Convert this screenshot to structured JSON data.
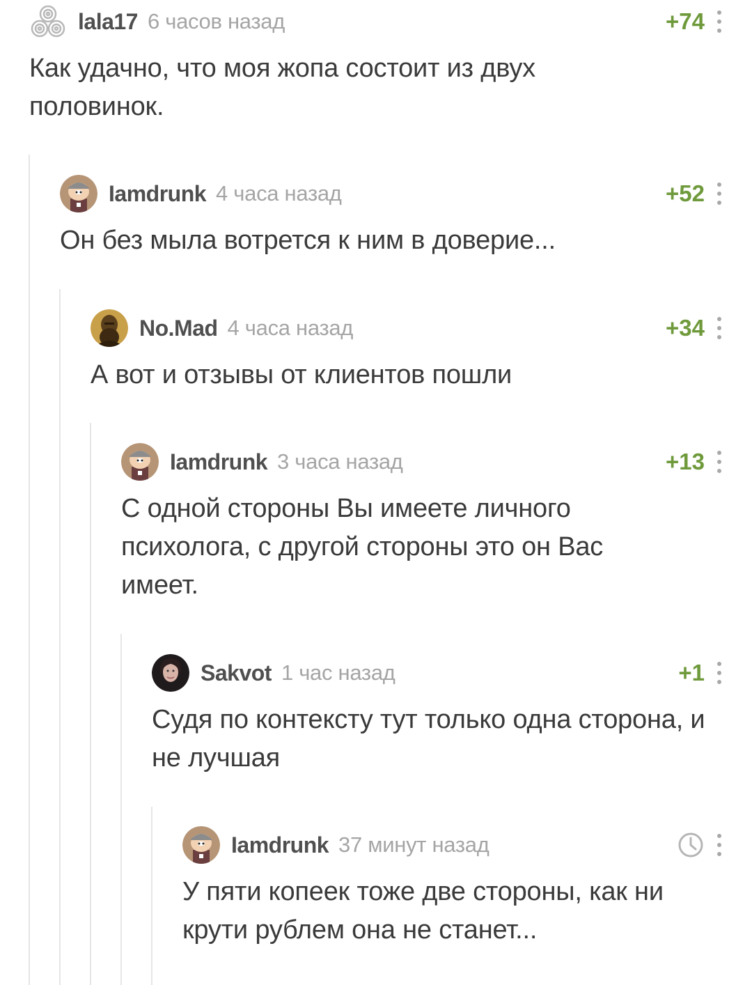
{
  "comments": [
    {
      "author": "lala17",
      "time": "6 часов назад",
      "rating": "+74",
      "text": "Как удачно, что моя жопа состоит из двух половинок.",
      "avatar_icon": "spiral-logo-avatar"
    },
    {
      "author": "Iamdrunk",
      "time": "4 часа назад",
      "rating": "+52",
      "text": "Он без мыла вотрется к ним в доверие...",
      "avatar_icon": "cartoon-character-avatar"
    },
    {
      "author": "No.Mad",
      "time": "4 часа назад",
      "rating": "+34",
      "text": "А вот и отзывы от клиентов пошли",
      "avatar_icon": "bearded-statue-avatar"
    },
    {
      "author": "Iamdrunk",
      "time": "3 часа назад",
      "rating": "+13",
      "text": "С одной стороны Вы имеете личного психолога, с другой стороны это он Вас имеет.",
      "avatar_icon": "cartoon-character-avatar"
    },
    {
      "author": "Sakvot",
      "time": "1 час назад",
      "rating": "+1",
      "text": "Судя по контексту тут только одна сторона, и не лучшая",
      "avatar_icon": "woman-photo-avatar"
    },
    {
      "author": "Iamdrunk",
      "time": "37 минут назад",
      "rating": "",
      "text": "У пяти копеек тоже две стороны, как ни крути рублем она не станет...",
      "avatar_icon": "cartoon-character-avatar",
      "status_icon": "clock-icon"
    }
  ],
  "colors": {
    "rating": "#6f9a3c",
    "author": "#4f4f4f",
    "time": "#a5a5a5",
    "thread_line": "#e6e6e6"
  }
}
